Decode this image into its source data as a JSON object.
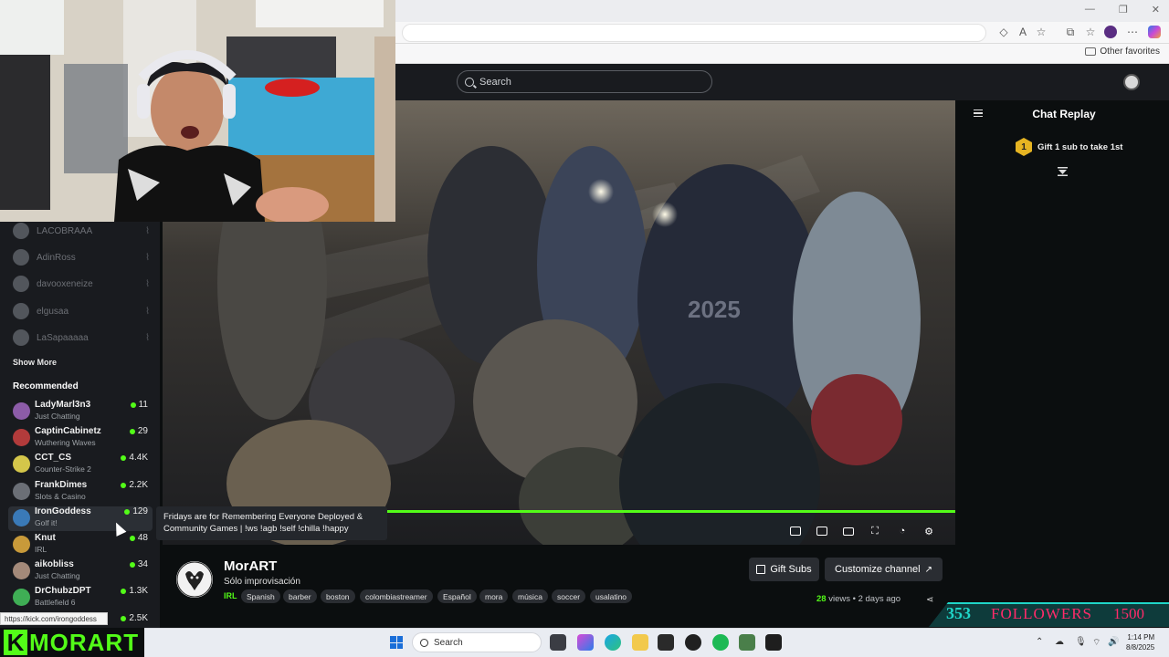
{
  "browser": {
    "other_favorites": "Other favorites",
    "status_url": "https://kick.com/irongoddess"
  },
  "header": {
    "search_placeholder": "Search"
  },
  "sidebar": {
    "following": [
      {
        "name": "LACOBRAAA"
      },
      {
        "name": "AdinRoss"
      },
      {
        "name": "davooxeneize"
      },
      {
        "name": "elgusaa"
      },
      {
        "name": "LaSapaaaaa"
      }
    ],
    "show_more": "Show More",
    "recommended_title": "Recommended",
    "recommended": [
      {
        "name": "LadyMarl3n3",
        "category": "Just Chatting",
        "viewers": "11",
        "avatar_color": "#8c5ca8"
      },
      {
        "name": "CaptinCabinetz",
        "category": "Wuthering Waves",
        "viewers": "29",
        "avatar_color": "#b23b3b"
      },
      {
        "name": "CCT_CS",
        "category": "Counter-Strike 2",
        "viewers": "4.4K",
        "avatar_color": "#d4c64a"
      },
      {
        "name": "FrankDimes",
        "category": "Slots & Casino",
        "viewers": "2.2K",
        "avatar_color": "#6b6f76"
      },
      {
        "name": "IronGoddess",
        "category": "Golf it!",
        "viewers": "129",
        "avatar_color": "#3a7ab8"
      },
      {
        "name": "Knut",
        "category": "IRL",
        "viewers": "48",
        "avatar_color": "#c89a3a"
      },
      {
        "name": "aikobliss",
        "category": "Just Chatting",
        "viewers": "34",
        "avatar_color": "#a48a7a"
      },
      {
        "name": "DrChubzDPT",
        "category": "Battlefield 6",
        "viewers": "1.3K",
        "avatar_color": "#3fae55"
      },
      {
        "name": "",
        "category": "",
        "viewers": "2.5K",
        "avatar_color": "#555"
      }
    ]
  },
  "tooltip": {
    "text": "Fridays are for Remembering Everyone Deployed & Community Games | !ws !agb !self !chilla !happy"
  },
  "video": {
    "progress_fraction": 1.0
  },
  "chat": {
    "title": "Chat Replay",
    "gift_rank": "1",
    "gift_text": "Gift 1 sub to take 1st"
  },
  "channel": {
    "name": "MorART",
    "title": "Sólo improvisación",
    "category": "IRL",
    "tags": [
      "Spanish",
      "barber",
      "boston",
      "colombiastreamer",
      "Español",
      "mora",
      "música",
      "soccer",
      "usalatino"
    ],
    "gift_subs": "Gift Subs",
    "customize": "Customize channel",
    "views_count": "28",
    "views_label": "views",
    "date_sep": "•",
    "date": "2 days ago"
  },
  "overlay": {
    "brand_k": "K",
    "brand_name": "MORART",
    "followers_count": "353",
    "followers_label": "FOLLOWERS",
    "followers_goal": "1500"
  },
  "taskbar": {
    "search": "Search",
    "time": "1:14 PM",
    "date": "8/8/2025"
  },
  "colors": {
    "kick_green": "#53fc18",
    "panel": "#191b1f",
    "followers_teal": "#1fd6c8",
    "followers_pink": "#ff2b6a"
  }
}
